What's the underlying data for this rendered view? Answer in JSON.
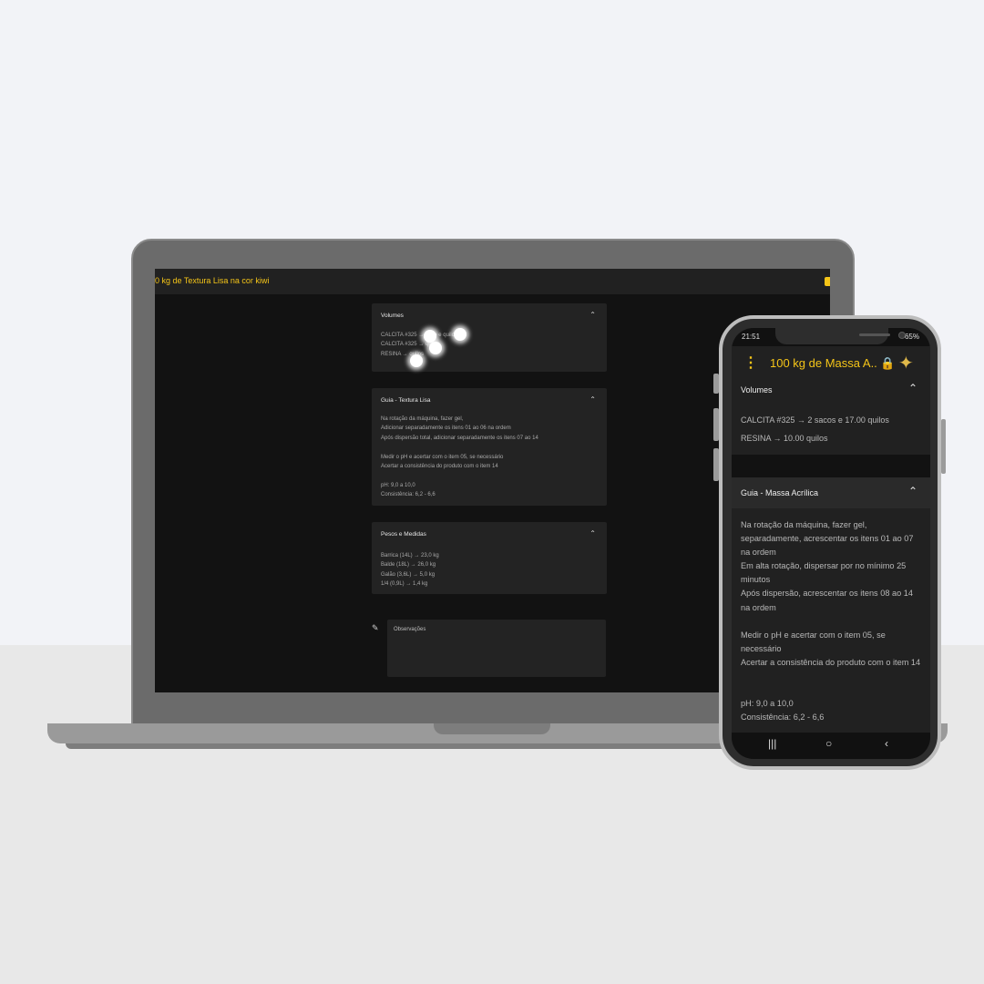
{
  "laptop": {
    "title": "0 kg de Textura Lisa na cor kiwi",
    "volumes": {
      "title": "Volumes",
      "lines": [
        "CALCITA #325 → saco e quilos",
        "CALCITA #325 → quilos",
        "RESINA → quilos"
      ]
    },
    "guia": {
      "title": "Guia - Textura Lisa",
      "lines": [
        "Na rotação da máquina, fazer gel,",
        "Adicionar separadamente os itens 01 ao 06 na ordem",
        "Após dispersão total, adicionar separadamente os itens 07 ao 14",
        "",
        "Medir o pH e acertar com o item 05, se necessário",
        "Acertar a consistência do produto com o item 14",
        "",
        "pH: 9,0 a 10,0",
        "Consistência: 6,2 - 6,6"
      ]
    },
    "pesos": {
      "title": "Pesos e Medidas",
      "lines": [
        "Barrica (14L) → 23,0 kg",
        "Balde (18L) → 26,0 kg",
        "Galão (3,6L) → 5,0 kg",
        "1/4 (0,9L) → 1,4 kg"
      ]
    },
    "observacoes_label": "Observações"
  },
  "phone": {
    "time": "21:51",
    "battery": "65%",
    "title": "100 kg de Massa A...",
    "volumes": {
      "title": "Volumes",
      "lines": [
        "CALCITA #325 → 2 sacos e 17.00 quilos",
        "RESINA → 10.00 quilos"
      ]
    },
    "guia": {
      "title": "Guia - Massa Acrílica",
      "para1": "Na rotação da máquina, fazer gel, separadamente, acrescentar os itens 01 ao 07 na ordem\nEm alta rotação, dispersar por no mínimo 25 minutos\nApós dispersão, acrescentar os itens 08 ao 14 na ordem",
      "para2": "Medir o pH e acertar com o item 05, se necessário\nAcertar a consistência do produto com o item 14",
      "para3": "pH: 9,0 a 10,0\nConsistência: 6,2 - 6,6"
    }
  },
  "icons": {
    "chevron": "chevron-up-icon",
    "lock": "lock-icon",
    "menu": "more-vert-icon",
    "logo": "hummingbird-logo-icon",
    "edit": "edit-icon"
  },
  "colors": {
    "accent": "#f5c518",
    "surface": "#232323",
    "background": "#121212"
  }
}
